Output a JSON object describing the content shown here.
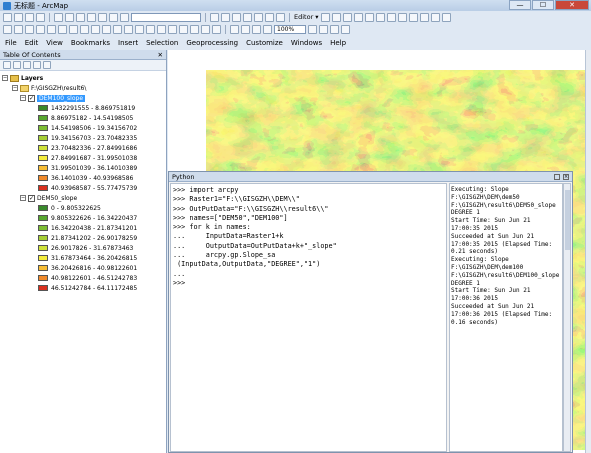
{
  "window": {
    "title": "无标题 - ArcMap",
    "buttons": [
      "—",
      "☐",
      "✕"
    ]
  },
  "toolbar": {
    "combo_scale": "",
    "editor_label": "Editor ▾",
    "zoom": "100%"
  },
  "menu": [
    "File",
    "Edit",
    "View",
    "Bookmarks",
    "Insert",
    "Selection",
    "Geoprocessing",
    "Customize",
    "Windows",
    "Help"
  ],
  "toc": {
    "title": "Table Of Contents",
    "root": "Layers",
    "folder": "F:\\GISGZH\\result6\\",
    "layer1": {
      "name": "DEM100_slope",
      "classes": [
        {
          "label": "1432291555 - 8.869751819",
          "color": "#3a8a2c"
        },
        {
          "label": "8.86975182 - 14.54198505",
          "color": "#58a72f"
        },
        {
          "label": "14.54198506 - 19.34156702",
          "color": "#7dbd33"
        },
        {
          "label": "19.34156703 - 23.70482335",
          "color": "#a6cf36"
        },
        {
          "label": "23.70482336 - 27.84991686",
          "color": "#cfe23a"
        },
        {
          "label": "27.84991687 - 31.99501038",
          "color": "#f3ec3d"
        },
        {
          "label": "31.99501039 - 36.14010389",
          "color": "#f6bd35"
        },
        {
          "label": "36.1401039 - 40.93968586",
          "color": "#ef8a2b"
        },
        {
          "label": "40.93968587 - 55.77475739",
          "color": "#d9311f"
        }
      ]
    },
    "layer2": {
      "name": "DEM50_slope",
      "classes": [
        {
          "label": "0 - 9.805322625",
          "color": "#3a8a2c"
        },
        {
          "label": "9.805322626 - 16.34220437",
          "color": "#58a72f"
        },
        {
          "label": "16.34220438 - 21.87341201",
          "color": "#7dbd33"
        },
        {
          "label": "21.87341202 - 26.90178259",
          "color": "#a6cf36"
        },
        {
          "label": "26.9017826 - 31.67873463",
          "color": "#cfe23a"
        },
        {
          "label": "31.67873464 - 36.20426815",
          "color": "#f3ec3d"
        },
        {
          "label": "36.20426816 - 40.98122601",
          "color": "#f6bd35"
        },
        {
          "label": "40.98122601 - 46.51242783",
          "color": "#ef8a2b"
        },
        {
          "label": "46.51242784 - 64.11172485",
          "color": "#d9311f"
        }
      ]
    }
  },
  "python": {
    "title": "Python",
    "code": [
      ">>> import arcpy",
      ">>> Raster1=\"F:\\\\GISGZH\\\\DEM\\\\\"",
      ">>> OutPutData=\"F:\\\\GISGZH\\\\result6\\\\\"",
      ">>> names=[\"DEM50\",\"DEM100\"]",
      ">>> for k in names:",
      "...     InputData=Raster1+k",
      "...     OutputData=OutPutData+k+\"_slope\"",
      "...     arcpy.gp.Slope_sa",
      " (InputData,OutputData,\"DEGREE\",\"1\")",
      "...",
      ">>>"
    ],
    "output": "Executing: Slope F:\\GISGZH\\DEM\\dem50 F:\\GISGZH\\result6\\DEM50_slope DEGREE 1\nStart Time: Sun Jun 21 17:00:35 2015\nSucceeded at Sun Jun 21 17:00:35 2015 (Elapsed Time: 0.21 seconds)\nExecuting: Slope F:\\GISGZH\\DEM\\dem100 F:\\GISGZH\\result6\\DEM100_slope DEGREE 1\nStart Time: Sun Jun 21 17:00:36 2015\nSucceeded at Sun Jun 21 17:00:36 2015 (Elapsed Time: 0.16 seconds)"
  }
}
